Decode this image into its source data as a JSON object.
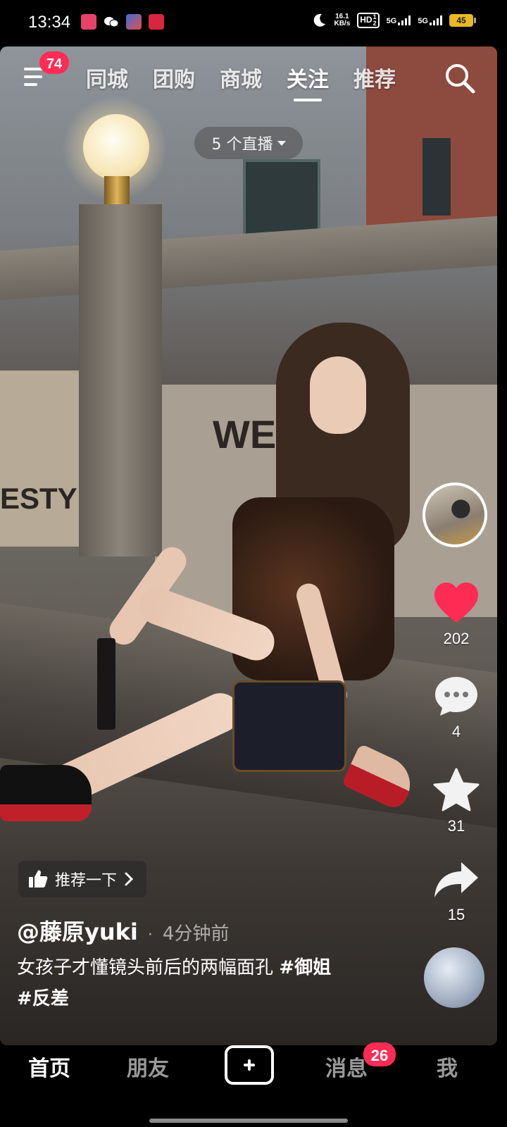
{
  "status_bar": {
    "time": "13:34",
    "speed_value": "16.1",
    "speed_unit": "KB/s",
    "hd_label": "HD",
    "hd_sub": "1",
    "hd_sub2": "2",
    "net1": "5G",
    "net2": "5G",
    "battery": "45"
  },
  "top_nav": {
    "menu_badge": "74",
    "tabs": [
      {
        "label": "同城"
      },
      {
        "label": "团购"
      },
      {
        "label": "商城"
      },
      {
        "label": "关注",
        "active": true
      },
      {
        "label": "推荐"
      }
    ]
  },
  "live_pill": {
    "label": "5 个直播"
  },
  "video_sign": {
    "text1": "ESTYLES",
    "text2": "WEL"
  },
  "actions": {
    "likes": "202",
    "comments": "4",
    "favorites": "31",
    "shares": "15"
  },
  "recommend": {
    "label": "推荐一下"
  },
  "post": {
    "author": "@藤原yuki",
    "dot": "·",
    "time_ago": "4分钟前",
    "caption": "女孩子才懂镜头前后的两幅面孔",
    "tag1": "#御姐",
    "tag2": "#反差"
  },
  "bottom_nav": {
    "home": "首页",
    "friends": "朋友",
    "messages": "消息",
    "messages_badge": "26",
    "me": "我"
  },
  "colors": {
    "accent_red": "#fe2c55",
    "like_heart": "#fe2c55"
  }
}
